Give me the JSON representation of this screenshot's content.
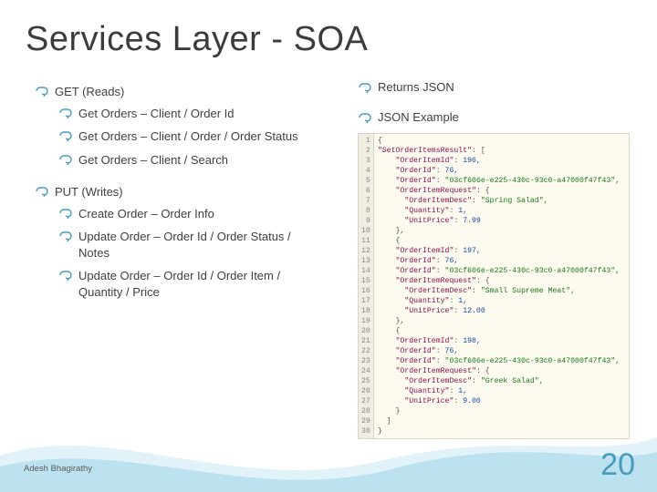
{
  "title": "Services Layer - SOA",
  "left": {
    "get_heading": "GET (Reads)",
    "get_items": [
      "Get Orders – Client / Order  Id",
      "Get Orders – Client / Order / Order Status",
      "Get Orders – Client / Search"
    ],
    "put_heading": "PUT (Writes)",
    "put_items": [
      "Create Order – Order Info",
      "Update Order – Order Id / Order Status / Notes",
      "Update Order – Order Id / Order Item / Quantity / Price"
    ]
  },
  "right": {
    "returns": "Returns JSON",
    "example": "JSON Example"
  },
  "json_sample": {
    "lines": [
      {
        "n": 1,
        "t": "brk",
        "txt": "{"
      },
      {
        "n": 2,
        "t": "kv",
        "k": "\"SetOrderItemsResult\"",
        "v": "[",
        "vt": "brk"
      },
      {
        "n": 3,
        "t": "kv",
        "k": "\"OrderItemId\"",
        "v": "196,",
        "vt": "num",
        "ind": 2
      },
      {
        "n": 4,
        "t": "kv",
        "k": "\"OrderId\"",
        "v": "76,",
        "vt": "num",
        "ind": 2
      },
      {
        "n": 5,
        "t": "kv",
        "k": "\"OrderId\"",
        "v": "\"03cf606e-e225-430c-93c0-a47000f47f43\",",
        "vt": "str",
        "ind": 2
      },
      {
        "n": 6,
        "t": "kv",
        "k": "\"OrderItemRequest\"",
        "v": "{",
        "vt": "brk",
        "ind": 2
      },
      {
        "n": 7,
        "t": "kv",
        "k": "\"OrderItemDesc\"",
        "v": "\"Spring Salad\",",
        "vt": "str",
        "ind": 3
      },
      {
        "n": 8,
        "t": "kv",
        "k": "\"Quantity\"",
        "v": "1,",
        "vt": "num",
        "ind": 3
      },
      {
        "n": 9,
        "t": "kv",
        "k": "\"UnitPrice\"",
        "v": "7.99",
        "vt": "num",
        "ind": 3
      },
      {
        "n": 10,
        "t": "brk",
        "txt": "},",
        "ind": 2
      },
      {
        "n": 11,
        "t": "brk",
        "txt": "{",
        "ind": 2
      },
      {
        "n": 12,
        "t": "kv",
        "k": "\"OrderItemId\"",
        "v": "197,",
        "vt": "num",
        "ind": 2
      },
      {
        "n": 13,
        "t": "kv",
        "k": "\"OrderId\"",
        "v": "76,",
        "vt": "num",
        "ind": 2
      },
      {
        "n": 14,
        "t": "kv",
        "k": "\"OrderId\"",
        "v": "\"03cf606e-e225-430c-93c0-a47000f47f43\",",
        "vt": "str",
        "ind": 2
      },
      {
        "n": 15,
        "t": "kv",
        "k": "\"OrderItemRequest\"",
        "v": "{",
        "vt": "brk",
        "ind": 2
      },
      {
        "n": 16,
        "t": "kv",
        "k": "\"OrderItemDesc\"",
        "v": "\"Small Supreme Meat\",",
        "vt": "str",
        "ind": 3
      },
      {
        "n": 17,
        "t": "kv",
        "k": "\"Quantity\"",
        "v": "1,",
        "vt": "num",
        "ind": 3
      },
      {
        "n": 18,
        "t": "kv",
        "k": "\"UnitPrice\"",
        "v": "12.00",
        "vt": "num",
        "ind": 3
      },
      {
        "n": 19,
        "t": "brk",
        "txt": "},",
        "ind": 2
      },
      {
        "n": 20,
        "t": "brk",
        "txt": "{",
        "ind": 2
      },
      {
        "n": 21,
        "t": "kv",
        "k": "\"OrderItemId\"",
        "v": "198,",
        "vt": "num",
        "ind": 2
      },
      {
        "n": 22,
        "t": "kv",
        "k": "\"OrderId\"",
        "v": "76,",
        "vt": "num",
        "ind": 2
      },
      {
        "n": 23,
        "t": "kv",
        "k": "\"OrderId\"",
        "v": "\"03cf606e-e225-430c-93c0-a47000f47f43\",",
        "vt": "str",
        "ind": 2
      },
      {
        "n": 24,
        "t": "kv",
        "k": "\"OrderItemRequest\"",
        "v": "{",
        "vt": "brk",
        "ind": 2
      },
      {
        "n": 25,
        "t": "kv",
        "k": "\"OrderItemDesc\"",
        "v": "\"Greek Salad\",",
        "vt": "str",
        "ind": 3
      },
      {
        "n": 26,
        "t": "kv",
        "k": "\"Quantity\"",
        "v": "1,",
        "vt": "num",
        "ind": 3
      },
      {
        "n": 27,
        "t": "kv",
        "k": "\"UnitPrice\"",
        "v": "9.00",
        "vt": "num",
        "ind": 3
      },
      {
        "n": 28,
        "t": "brk",
        "txt": "}",
        "ind": 2
      },
      {
        "n": 29,
        "t": "brk",
        "txt": "]",
        "ind": 1
      },
      {
        "n": 30,
        "t": "brk",
        "txt": "}"
      }
    ]
  },
  "footer": {
    "author": "Adesh Bhagirathy",
    "page": "20"
  },
  "colors": {
    "accent": "#469bbd"
  }
}
